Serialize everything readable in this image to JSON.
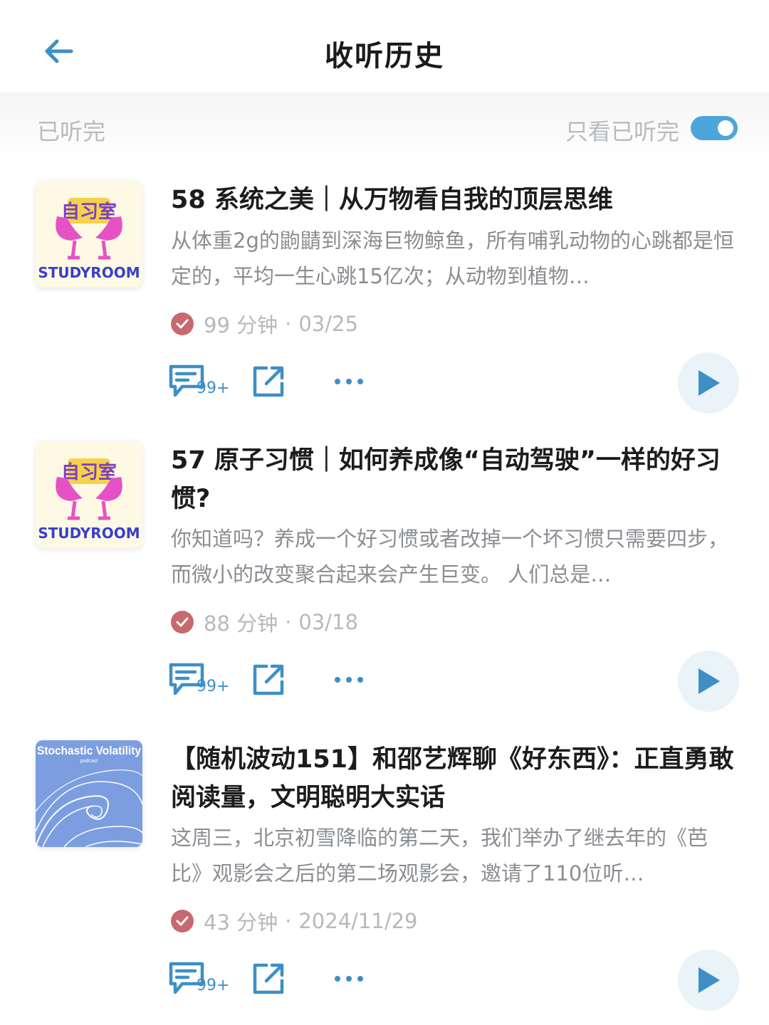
{
  "header": {
    "title": "收听历史"
  },
  "filter": {
    "label": "已听完",
    "toggle_label": "只看已听完",
    "toggle_on": true
  },
  "colors": {
    "accent": "#3d8fc6",
    "toggle": "#4ca6db",
    "check": "#c66a6f",
    "muted": "#b6b9bc"
  },
  "items": [
    {
      "cover": "studyroom",
      "cover_text": {
        "cn": "自习室",
        "en": "STUDYROOM"
      },
      "title": "58 系统之美｜从万物看自我的顶层思维",
      "desc": "从体重2g的鼩鼱到深海巨物鲸鱼，所有哺乳动物的心跳都是恒定的，平均一生心跳15亿次；从动物到植物…",
      "duration": "99 分钟",
      "date": "03/25",
      "comments": "99+"
    },
    {
      "cover": "studyroom",
      "cover_text": {
        "cn": "自习室",
        "en": "STUDYROOM"
      },
      "title": "57 原子习惯｜如何养成像“自动驾驶”一样的好习惯?",
      "desc": "你知道吗？养成一个好习惯或者改掉一个坏习惯只需要四步，而微小的改变聚合起来会产生巨变。 人们总是…",
      "duration": "88 分钟",
      "date": "03/18",
      "comments": "99+"
    },
    {
      "cover": "stochastic",
      "cover_text": {
        "title": "Stochastic Volatility",
        "sub": "podcast"
      },
      "title": "【随机波动151】和邵艺辉聊《好东西》：正直勇敢阅读量，文明聪明大实话",
      "desc": "这周三，北京初雪降临的第二天，我们举办了继去年的《芭比》观影会之后的第二场观影会，邀请了110位听…",
      "duration": "43 分钟",
      "date": "2024/11/29",
      "comments": "99+"
    }
  ],
  "icons": [
    "back-arrow-icon",
    "check-icon",
    "comment-icon",
    "share-icon",
    "more-icon",
    "play-icon"
  ]
}
